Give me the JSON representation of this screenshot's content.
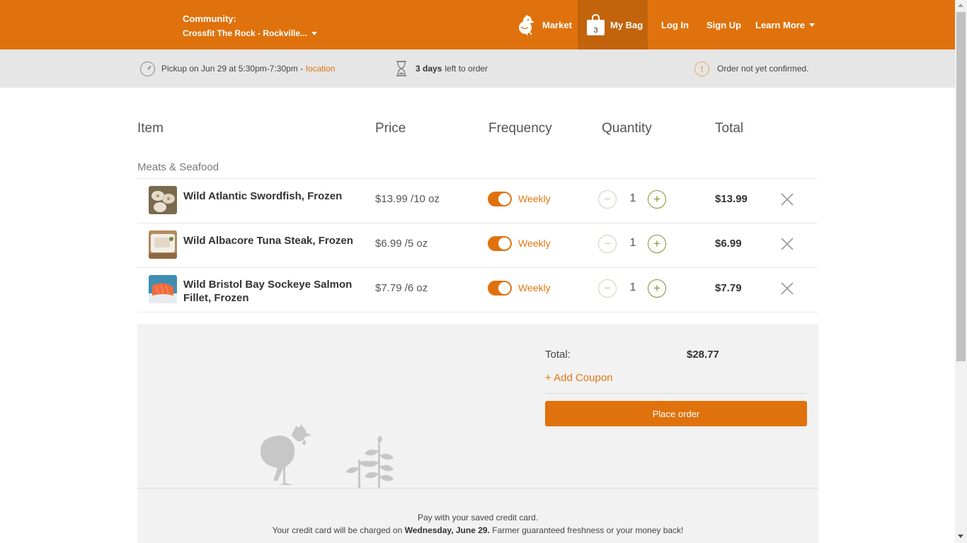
{
  "header": {
    "community_label": "Community:",
    "community_name": "Crossfit The Rock - Rockville...",
    "nav": {
      "market": "Market",
      "bag": "My Bag",
      "bag_count": "3",
      "login": "Log In",
      "signup": "Sign Up",
      "learn_more": "Learn More"
    },
    "colors": {
      "brand": "#df720c",
      "active_tab": "#c2640b"
    }
  },
  "info": {
    "pickup_prefix": "Pickup on",
    "pickup_time": "Jun 29 at 5:30pm-7:30pm",
    "pickup_sep": "-",
    "location_link": "location",
    "days_count": "3 days",
    "days_suffix": "left to order",
    "status": "Order not yet confirmed."
  },
  "cart": {
    "columns": {
      "item": "Item",
      "price": "Price",
      "frequency": "Frequency",
      "quantity": "Quantity",
      "total": "Total"
    },
    "category": "Meats & Seafood",
    "items": [
      {
        "name": "Wild Atlantic Swordfish, Frozen",
        "price": "$13.99 /10 oz",
        "frequency": "Weekly",
        "quantity": "1",
        "total": "$13.99"
      },
      {
        "name": "Wild Albacore Tuna Steak, Frozen",
        "price": "$6.99 /5 oz",
        "frequency": "Weekly",
        "quantity": "1",
        "total": "$6.99"
      },
      {
        "name": "Wild Bristol Bay Sockeye Salmon Fillet, Frozen",
        "price": "$7.79 /6 oz",
        "frequency": "Weekly",
        "quantity": "1",
        "total": "$7.79"
      }
    ],
    "minus_symbol": "−",
    "plus_symbol": "+"
  },
  "summary": {
    "total_label": "Total:",
    "total_value": "$28.77",
    "coupon": "+ Add Coupon",
    "place_order": "Place order",
    "payment_line1": "Pay with your saved credit card.",
    "payment_line2_prefix": "Your credit card will be charged on",
    "payment_date": "Wednesday, June 29.",
    "payment_line2_suffix": "Farmer guaranteed freshness or your money back!"
  },
  "icons": {
    "market": "chicken-icon",
    "bag": "shopping-bag-icon",
    "pickup": "clock-icon",
    "days": "hourglass-icon",
    "status": "alert-icon",
    "remove": "close-icon"
  }
}
